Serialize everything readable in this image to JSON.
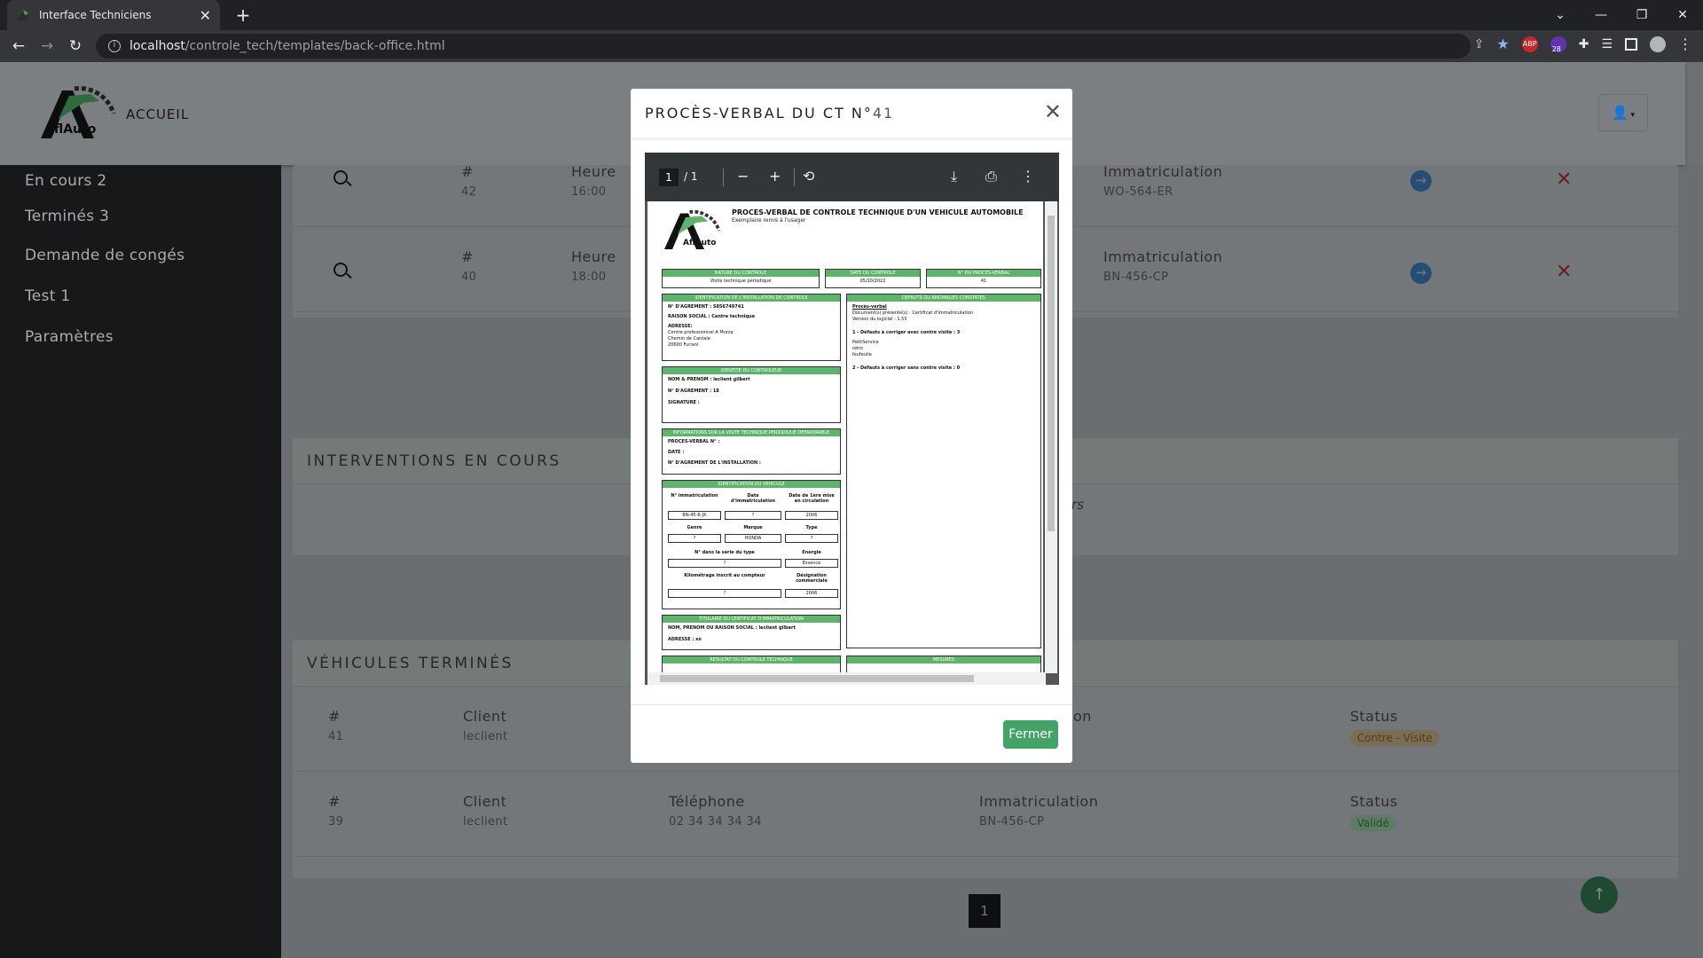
{
  "browser": {
    "tab_title": "Interface Techniciens",
    "tab_close": "✕",
    "new_tab": "+",
    "url_host": "localhost",
    "url_path": "/controle_tech/templates/back-office.html",
    "ext_badge": "28",
    "ext_abp": "ABP"
  },
  "nav": {
    "brand": "AflAuto",
    "accueil": "ACCUEIL",
    "user_icon": "user-icon"
  },
  "sidebar": {
    "items": [
      {
        "label": "En cours 2"
      },
      {
        "label": "Terminés 3"
      },
      {
        "label": "Demande de congés"
      },
      {
        "label": "Test 1"
      },
      {
        "label": "Paramètres"
      }
    ]
  },
  "waiting": {
    "rows": [
      {
        "hash": "#",
        "id": "42",
        "time_label": "Heure",
        "time": "16:00",
        "plate_label": "Immatriculation",
        "plate": "WO-564-ER"
      },
      {
        "hash": "#",
        "id": "40",
        "time_label": "Heure",
        "time": "18:00",
        "plate_label": "Immatriculation",
        "plate": "BN-456-CP"
      }
    ]
  },
  "interventions": {
    "title": "INTERVENTIONS EN COURS",
    "fragment": "rs"
  },
  "termines": {
    "title": "VÉHICULES TERMINÉS",
    "rows": [
      {
        "hash": "#",
        "id": "41",
        "client_label": "Client",
        "client": "leclient",
        "status_label": "Status",
        "status": "Contre - Visite",
        "plate_fragment": "on"
      },
      {
        "hash": "#",
        "id": "39",
        "client_label": "Client",
        "client": "leclient",
        "phone_label": "Téléphone",
        "phone": "02 34 34 34 34",
        "plate_label": "Immatriculation",
        "plate": "BN-456-CP",
        "status_label": "Status",
        "status": "Validé"
      }
    ]
  },
  "pagination": {
    "page": "1"
  },
  "colors": {
    "accent": "#43a367",
    "sidebar": "#16181a",
    "contre_visite": "#f0a93b",
    "valide": "#43a367"
  },
  "modal": {
    "title": "PROCÈS-VERBAL DU CT N°",
    "number": "41",
    "close_button": "Fermer",
    "viewer": {
      "page_current": "1",
      "page_total": "/ 1"
    },
    "pdf": {
      "heading": "PROCES-VERBAL DE CONTROLE TECHNIQUE D'UN VEHICULE AUTOMOBILE",
      "subheading": "Exemplaire remis à l'usager",
      "brand": "AflAuto",
      "nature_head": "NATURE DU CONTROLE",
      "nature_val": "Visite technique périodique",
      "date_head": "DATE DU CONTROLE",
      "date_val": "05/10/2022",
      "pv_head": "N° DU PROCES-VERBAL",
      "pv_val": "41",
      "ident_head": "IDENTIFICATION DE L'INSTALLATION DE CONTROLE",
      "agrement": "N° D'AGREMENT : S856749741",
      "raison": "RAISON SOCIAL : Centre technique",
      "adresse_lab": "ADRESSE:",
      "adresse_1": "Centre professionnel A Murza",
      "adresse_2": "Chemin de Cantale",
      "adresse_3": "20600 Furiani",
      "defauts_head": "DEFAUTS OU ANOMALIES CONSTATES",
      "pv_link": "Procès-verbal",
      "docs": "Document(s) présenté(s) : Certificat d'immatriculation",
      "version": "Version du logiciel : 1.55",
      "def1": "1 - Défauts à corriger avec contre visite : 3",
      "def1_a": "PetitService",
      "def1_b": "retro",
      "def1_c": "feufeuile",
      "def2": "2 - Défauts à corriger sans contre visite : 0",
      "controleur_head": "IDENTITE DU CONTROLEUR",
      "ctrl_nom": "NOM & PRENOM : leclient gilbert",
      "ctrl_agr": "N° D'AGREMENT : 18",
      "ctrl_sig": "SIGNATURE :",
      "info_head": "INFORMATIONS SUR LA VISITE TECHNIQUE PERIODIQUE DEFAVORABLE",
      "info_pv": "PROCES-VERBAL N° :",
      "info_date": "DATE :",
      "info_agr": "N° D'AGREMENT DE L'INSTALLATION :",
      "veh_head": "IDENTIFICATION DU VEHICULE",
      "veh_labels": [
        "N° immatriculation",
        "Date d'immatriculation",
        "Date de 1ère mise en circulation"
      ],
      "veh_vals": [
        "BN-45-6-JK",
        "?",
        "2006"
      ],
      "veh_labels2": [
        "Genre",
        "Marque",
        "Type"
      ],
      "veh_vals2": [
        "?",
        "HONDA",
        "?"
      ],
      "veh_labels3": [
        "N° dans la série du type",
        "Energie"
      ],
      "veh_vals3": [
        "?",
        "Essence"
      ],
      "veh_labels4": [
        "Kilométrage inscrit au compteur",
        "Désignation commerciale"
      ],
      "veh_vals4": [
        "?",
        "2006"
      ],
      "titulaire_head": "TITULAIRE DU CERTIFICAT D'IMMATRICULATION",
      "tit_nom": "NOM, PRENOM OU RAISON SOCIAL : leclient gilbert",
      "tit_adr": "ADRESSE : xo",
      "result_head": "RESULTAT DU CONTROLE TECHNIQUE",
      "mesures_head": "MESURES"
    }
  }
}
